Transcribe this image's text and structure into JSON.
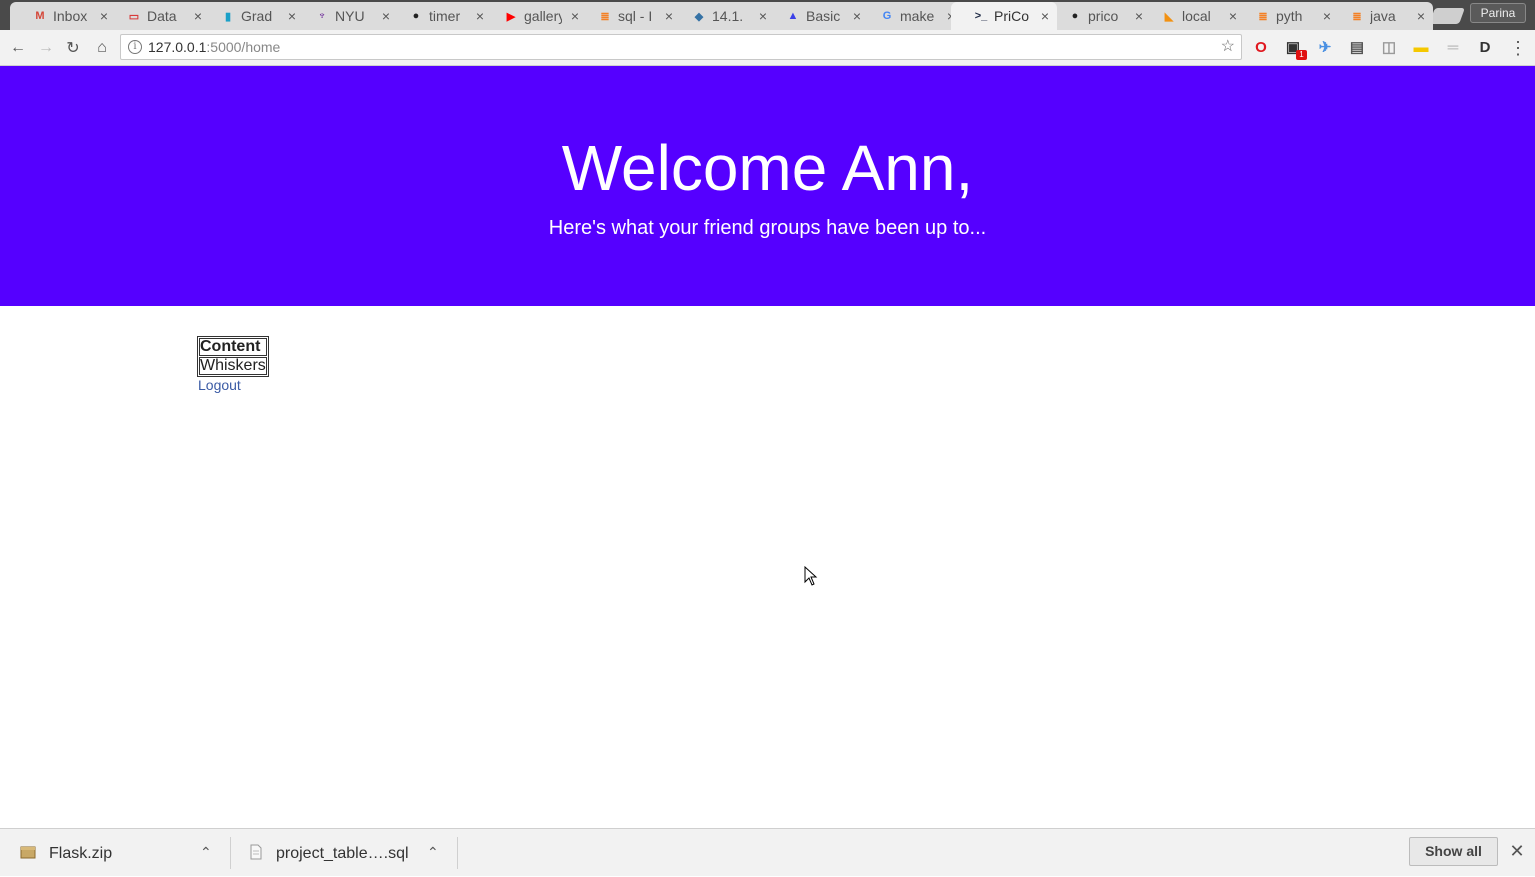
{
  "browser": {
    "tabs": [
      {
        "title": "Inbox",
        "icon": "gmail-icon",
        "icon_glyph": "M",
        "icon_color": "#d44638",
        "active": false
      },
      {
        "title": "Data",
        "icon": "data-icon",
        "icon_glyph": "▭",
        "icon_color": "#d83b3b",
        "active": false
      },
      {
        "title": "Grad",
        "icon": "bar-chart-icon",
        "icon_glyph": "▮",
        "icon_color": "#1aa0c8",
        "active": false
      },
      {
        "title": "NYU",
        "icon": "nyu-icon",
        "icon_glyph": "♆",
        "icon_color": "#57068c",
        "active": false
      },
      {
        "title": "timer",
        "icon": "github-icon",
        "icon_glyph": "●",
        "icon_color": "#222222",
        "active": false
      },
      {
        "title": "gallery",
        "icon": "youtube-icon",
        "icon_glyph": "▶",
        "icon_color": "#ff0000",
        "active": false
      },
      {
        "title": "sql - I",
        "icon": "stackoverflow-icon",
        "icon_glyph": "≣",
        "icon_color": "#f48024",
        "active": false
      },
      {
        "title": "14.1.",
        "icon": "python-icon",
        "icon_glyph": "◆",
        "icon_color": "#3572a5",
        "active": false
      },
      {
        "title": "Basic",
        "icon": "atlassian-icon",
        "icon_glyph": "▲",
        "icon_color": "#3b40e8",
        "active": false
      },
      {
        "title": "make",
        "icon": "google-icon",
        "icon_glyph": "G",
        "icon_color": "#4285f4",
        "active": false
      },
      {
        "title": "PriCo",
        "icon": "terminal-icon",
        "icon_glyph": ">_",
        "icon_color": "#1f2b46",
        "active": true
      },
      {
        "title": "prico",
        "icon": "github-icon",
        "icon_glyph": "●",
        "icon_color": "#222222",
        "active": false
      },
      {
        "title": "local",
        "icon": "phpmyadmin-icon",
        "icon_glyph": "◣",
        "icon_color": "#f29111",
        "active": false
      },
      {
        "title": "pyth",
        "icon": "stackoverflow-icon",
        "icon_glyph": "≣",
        "icon_color": "#f48024",
        "active": false
      },
      {
        "title": "java",
        "icon": "stackoverflow-icon",
        "icon_glyph": "≣",
        "icon_color": "#f48024",
        "active": false
      }
    ],
    "profile_name": "Parina",
    "url_host": "127.0.0.1",
    "url_rest": ":5000/home",
    "extensions": [
      {
        "name": "opera-icon",
        "glyph": "O",
        "color": "#e0181f"
      },
      {
        "name": "extension-badge-icon",
        "glyph": "▣",
        "color": "#333333",
        "badge": "1"
      },
      {
        "name": "compass-icon",
        "glyph": "✈",
        "color": "#4a90e2"
      },
      {
        "name": "clipboard-icon",
        "glyph": "▤",
        "color": "#555555"
      },
      {
        "name": "camera-icon",
        "glyph": "◫",
        "color": "#9a9a9a"
      },
      {
        "name": "sticky-note-icon",
        "glyph": "▬",
        "color": "#f5c800"
      },
      {
        "name": "shelf-icon",
        "glyph": "═",
        "color": "#b5b5b5"
      },
      {
        "name": "dashlane-icon",
        "glyph": "D",
        "color": "#333333"
      }
    ]
  },
  "page": {
    "heading": "Welcome Ann,",
    "subheading": "Here's what your friend groups have been up to...",
    "table": {
      "header": "Content",
      "rows": [
        "Whiskers"
      ]
    },
    "logout_label": "Logout"
  },
  "downloads": {
    "items": [
      {
        "name": "Flask.zip",
        "icon": "zip-file-icon"
      },
      {
        "name": "project_table….sql",
        "icon": "sql-file-icon"
      }
    ],
    "show_all_label": "Show all"
  },
  "colors": {
    "hero_background": "#5500ff",
    "link": "#3b5ba5"
  }
}
